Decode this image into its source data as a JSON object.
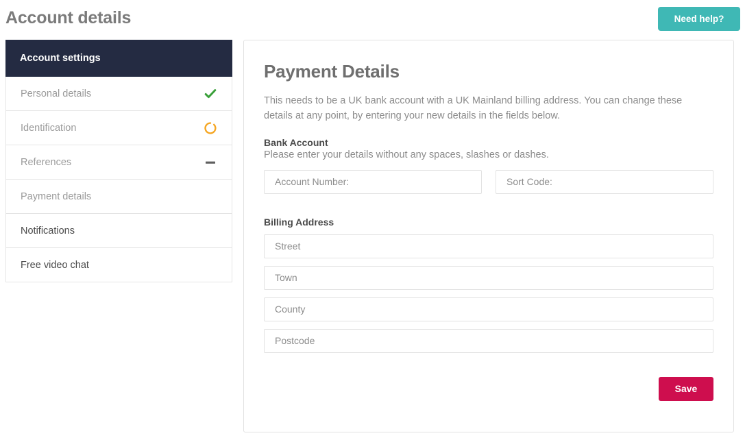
{
  "header": {
    "title": "Account details",
    "help_button": "Need help?"
  },
  "sidebar": {
    "heading": "Account settings",
    "items": [
      {
        "label": "Personal details",
        "status": "complete",
        "status_icon": "check-icon",
        "muted": true
      },
      {
        "label": "Identification",
        "status": "in-progress",
        "status_icon": "circle-ring-icon",
        "muted": true
      },
      {
        "label": "References",
        "status": "not-started",
        "status_icon": "dash-icon",
        "muted": true
      },
      {
        "label": "Payment details",
        "status": "none",
        "status_icon": "",
        "muted": true
      },
      {
        "label": "Notifications",
        "status": "none",
        "status_icon": "",
        "muted": false
      },
      {
        "label": "Free video chat",
        "status": "none",
        "status_icon": "",
        "muted": false
      }
    ]
  },
  "main": {
    "title": "Payment Details",
    "intro": "This needs to be a UK bank account with a UK Mainland billing address. You can change these details at any point, by entering your new details in the fields below.",
    "bank_account": {
      "title": "Bank Account",
      "note": "Please enter your details without any spaces, slashes or dashes.",
      "account_number_placeholder": "Account Number:",
      "account_number_value": "",
      "sort_code_placeholder": "Sort Code:",
      "sort_code_value": ""
    },
    "billing_address": {
      "title": "Billing Address",
      "street_placeholder": "Street",
      "street_value": "",
      "town_placeholder": "Town",
      "town_value": "",
      "county_placeholder": "County",
      "county_value": "",
      "postcode_placeholder": "Postcode",
      "postcode_value": ""
    },
    "save_button": "Save"
  },
  "colors": {
    "navy": "#242b42",
    "teal": "#3fb8b5",
    "crimson": "#ce0e4e",
    "check_green": "#3aa03a",
    "ring_amber": "#f5a623",
    "dash_gray": "#5f5f5f"
  }
}
